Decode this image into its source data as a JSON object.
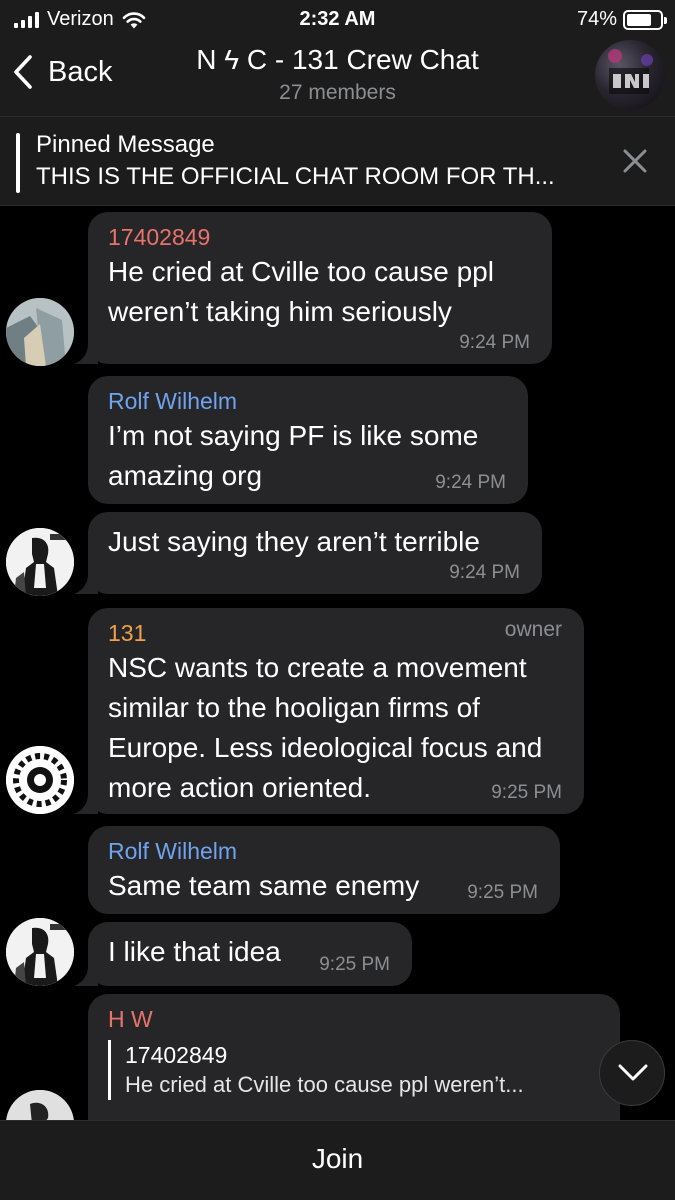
{
  "status_bar": {
    "carrier": "Verizon",
    "time": "2:32 AM",
    "battery_text": "74%",
    "battery_level": 0.74,
    "icons": [
      "signal-bars-icon",
      "wifi-icon",
      "battery-icon"
    ]
  },
  "header": {
    "back_label": "Back",
    "title": "N ϟ C - 131 Crew Chat",
    "subtitle": "27 members"
  },
  "pinned": {
    "title": "Pinned Message",
    "text": "THIS IS THE OFFICIAL CHAT ROOM FOR TH..."
  },
  "messages": [
    {
      "sender": "17402849",
      "sender_color": "#e8736a",
      "text": "He cried at Cville too cause ppl weren’t taking him seriously",
      "time": "9:24 PM"
    },
    {
      "sender": "Rolf Wilhelm",
      "sender_color": "#6fa3ef",
      "text": "I’m not saying PF is like some amazing org",
      "time": "9:24 PM"
    },
    {
      "text": "Just saying they aren’t terrible",
      "time": "9:24 PM"
    },
    {
      "sender": "131",
      "sender_color": "#f0a24b",
      "role": "owner",
      "text": "NSC wants to create a movement similar to the hooligan firms of Europe. Less ideological focus and more action oriented.",
      "time": "9:25 PM"
    },
    {
      "sender": "Rolf Wilhelm",
      "sender_color": "#6fa3ef",
      "text": "Same team same enemy",
      "time": "9:25 PM"
    },
    {
      "text": "I like that idea",
      "time": "9:25 PM"
    },
    {
      "sender": "H W",
      "sender_color": "#e8736a",
      "reply": {
        "name": "17402849",
        "text": "He cried at Cville too cause ppl weren’t..."
      }
    }
  ],
  "bottom": {
    "join_label": "Join"
  },
  "colors": {
    "background": "#000000",
    "bar": "#1c1c1d",
    "bubble": "#262628",
    "muted": "#8d8e93"
  }
}
